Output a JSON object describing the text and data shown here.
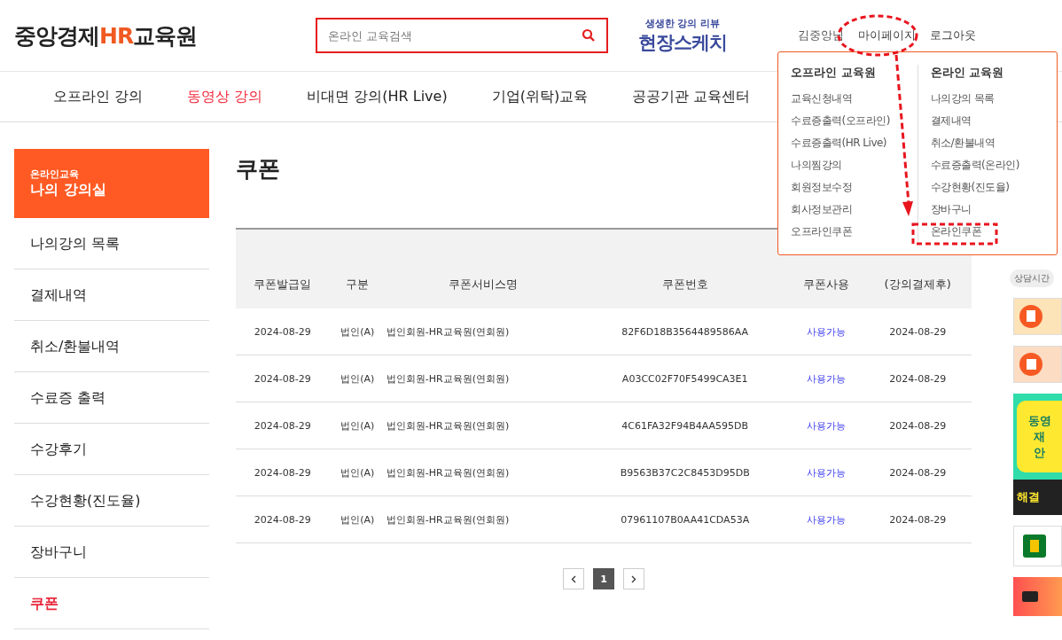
{
  "header": {
    "logo_parts": [
      {
        "text": "중앙경제",
        "accent": false
      },
      {
        "text": "HR",
        "accent": true
      },
      {
        "text": "교육원",
        "accent": false
      }
    ],
    "search": {
      "placeholder": "온라인 교육검색"
    },
    "promo": {
      "subtitle": "생생한 강의 리뷰",
      "title": "현장스케치"
    },
    "user": {
      "name": "김중앙님",
      "links": [
        "마이페이지",
        "로그아웃"
      ]
    }
  },
  "nav": [
    {
      "label": "오프라인 강의",
      "selected": false
    },
    {
      "label": "동영상 강의",
      "selected": true
    },
    {
      "label": "비대면 강의(HR Live)",
      "selected": false
    },
    {
      "label": "기업(위탁)교육",
      "selected": false
    },
    {
      "label": "공공기관 교육센터",
      "selected": false
    }
  ],
  "sidebar": {
    "caption": "온라인교육",
    "title": "나의 강의실",
    "items": [
      {
        "label": "나의강의 목록",
        "selected": false
      },
      {
        "label": "결제내역",
        "selected": false
      },
      {
        "label": "취소/환불내역",
        "selected": false
      },
      {
        "label": "수료증 출력",
        "selected": false
      },
      {
        "label": "수강후기",
        "selected": false
      },
      {
        "label": "수강현황(진도율)",
        "selected": false
      },
      {
        "label": "장바구니",
        "selected": false
      },
      {
        "label": "쿠폰",
        "selected": true
      }
    ]
  },
  "page_title": "쿠폰",
  "table": {
    "columns": [
      "쿠폰발급일",
      "구분",
      "쿠폰서비스명",
      "쿠폰번호",
      "쿠폰사용",
      "(강의결제후)"
    ],
    "rows": [
      [
        "2024-08-29",
        "법인(A)",
        "법인회원-HR교육원(연회원)",
        "82F6D18B3564489586AA",
        "사용가능",
        "2024-08-29"
      ],
      [
        "2024-08-29",
        "법인(A)",
        "법인회원-HR교육원(연회원)",
        "A03CC02F70F5499CA3E1",
        "사용가능",
        "2024-08-29"
      ],
      [
        "2024-08-29",
        "법인(A)",
        "법인회원-HR교육원(연회원)",
        "4C61FA32F94B4AA595DB",
        "사용가능",
        "2024-08-29"
      ],
      [
        "2024-08-29",
        "법인(A)",
        "법인회원-HR교육원(연회원)",
        "B9563B37C2C8453D95DB",
        "사용가능",
        "2024-08-29"
      ],
      [
        "2024-08-29",
        "법인(A)",
        "법인회원-HR교육원(연회원)",
        "07961107B0AA41CDA53A",
        "사용가능",
        "2024-08-29"
      ]
    ]
  },
  "pagination": {
    "pages": [
      {
        "label": "1",
        "selected": true
      }
    ]
  },
  "dropdown": {
    "columns": [
      {
        "heading": "오프라인 교육원",
        "items": [
          "교육신청내역",
          "수료증출력(오프라인)",
          "수료증출력(HR Live)",
          "나의찜강의",
          "회원정보수정",
          "회사정보관리",
          "오프라인쿠폰"
        ]
      },
      {
        "heading": "온라인 교육원",
        "items": [
          "나의강의 목록",
          "결제내역",
          "취소/환불내역",
          "수료증출력(온라인)",
          "수강현황(진도율)",
          "장바구니",
          "온라인쿠폰"
        ]
      }
    ]
  },
  "right_rail": {
    "consult_label": "상담시간",
    "banner_lines": [
      "동영",
      "재",
      "안"
    ],
    "banner_footer": "해결"
  }
}
